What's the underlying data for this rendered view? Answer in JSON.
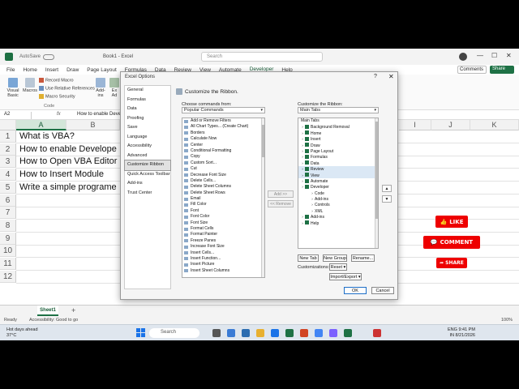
{
  "titlebar": {
    "autosave": "AutoSave",
    "autosave_state": "Off",
    "filename": "Book1 - Excel",
    "search_placeholder": "Search",
    "min": "—",
    "max": "☐",
    "close": "✕"
  },
  "ribbon_tabs": [
    "File",
    "Home",
    "Insert",
    "Draw",
    "Page Layout",
    "Formulas",
    "Data",
    "Review",
    "View",
    "Automate",
    "Developer",
    "Help"
  ],
  "active_tab": "Developer",
  "comments_label": "Comments",
  "share_label": "Share",
  "ribbon": {
    "visual_basic": "Visual Basic",
    "macros": "Macros",
    "record_macro": "Record Macro",
    "relative_refs": "Use Relative References",
    "macro_security": "Macro Security",
    "group_code": "Code",
    "addins": "Add-ins",
    "excel_addins": "Ex Ad",
    "com": "C",
    "properties": "P",
    "insert": "Inse"
  },
  "formula_bar": {
    "name_box": "A2",
    "fx": "fx",
    "content": "How to enable Develo"
  },
  "grid": {
    "columns_left": [
      "A",
      "B"
    ],
    "columns_right": [
      "I",
      "J",
      "K"
    ],
    "rows": [
      "1",
      "2",
      "3",
      "4",
      "5",
      "6",
      "7",
      "8",
      "9",
      "10",
      "11",
      "12"
    ],
    "cells": [
      "What is VBA?",
      "How to enable Develope",
      "How to Open VBA Editor",
      "How to Insert Module",
      "Write a simple programe"
    ]
  },
  "sheet_tab": "Sheet1",
  "status": {
    "ready": "Ready",
    "accessibility": "Accessibility: Good to go",
    "zoom": "100%"
  },
  "taskbar": {
    "weather_line1": "Hot days ahead",
    "weather_line2": "37°C",
    "search_placeholder": "Search",
    "lang1": "ENG",
    "lang2": "IN",
    "time": "9:41 PM",
    "date": "8/21/2026"
  },
  "dialog": {
    "title": "Excel Options",
    "help": "?",
    "close": "✕",
    "nav": [
      "General",
      "Formulas",
      "Data",
      "Proofing",
      "Save",
      "Language",
      "Accessibility",
      "Advanced",
      "Customize Ribbon",
      "Quick Access Toolbar",
      "Add-ins",
      "Trust Center"
    ],
    "nav_selected": "Customize Ribbon",
    "heading": "Customize the Ribbon.",
    "choose_label": "Choose commands from:",
    "choose_value": "Popular Commands",
    "customize_label": "Customize the Ribbon:",
    "customize_value": "Main Tabs",
    "commands": [
      "Add or Remove Filters",
      "All Chart Types... (Create Chart)",
      "Borders",
      "Calculate Now",
      "Center",
      "Conditional Formatting",
      "Copy",
      "Custom Sort...",
      "Cut",
      "Decrease Font Size",
      "Delete Cells...",
      "Delete Sheet Columns",
      "Delete Sheet Rows",
      "Email",
      "Fill Color",
      "Font",
      "Font Color",
      "Font Size",
      "Format Cells",
      "Format Painter",
      "Freeze Panes",
      "Increase Font Size",
      "Insert Cells...",
      "Insert Function...",
      "Insert Picture",
      "Insert Sheet Columns"
    ],
    "add_btn": "Add >>",
    "remove_btn": "<< Remove",
    "tree_header": "Main Tabs",
    "tree": [
      {
        "label": "Background Removal",
        "level": 0,
        "check": true
      },
      {
        "label": "Home",
        "level": 0,
        "check": true
      },
      {
        "label": "Insert",
        "level": 0,
        "check": true
      },
      {
        "label": "Draw",
        "level": 0,
        "check": true
      },
      {
        "label": "Page Layout",
        "level": 0,
        "check": true
      },
      {
        "label": "Formulas",
        "level": 0,
        "check": true
      },
      {
        "label": "Data",
        "level": 0,
        "check": true
      },
      {
        "label": "Review",
        "level": 0,
        "check": true
      },
      {
        "label": "View",
        "level": 0,
        "check": true
      },
      {
        "label": "Automate",
        "level": 0,
        "check": true
      },
      {
        "label": "Developer",
        "level": 0,
        "check": true
      },
      {
        "label": "Code",
        "level": 1,
        "check": false
      },
      {
        "label": "Add-ins",
        "level": 1,
        "check": false
      },
      {
        "label": "Controls",
        "level": 1,
        "check": false
      },
      {
        "label": "XML",
        "level": 1,
        "check": false
      },
      {
        "label": "Add-ins",
        "level": 0,
        "check": true
      },
      {
        "label": "Help",
        "level": 0,
        "check": true
      }
    ],
    "new_tab": "New Tab",
    "new_group": "New Group",
    "rename": "Rename...",
    "customizations_label": "Customizations:",
    "reset": "Reset ▾",
    "import_export": "Import/Export ▾",
    "ok": "OK",
    "cancel": "Cancel"
  },
  "overlays": {
    "like": "LIKE",
    "comment": "COMMENT",
    "share": "SHARE"
  },
  "colors": {
    "excel_green": "#1e7145",
    "overlay_red": "#e00000"
  }
}
